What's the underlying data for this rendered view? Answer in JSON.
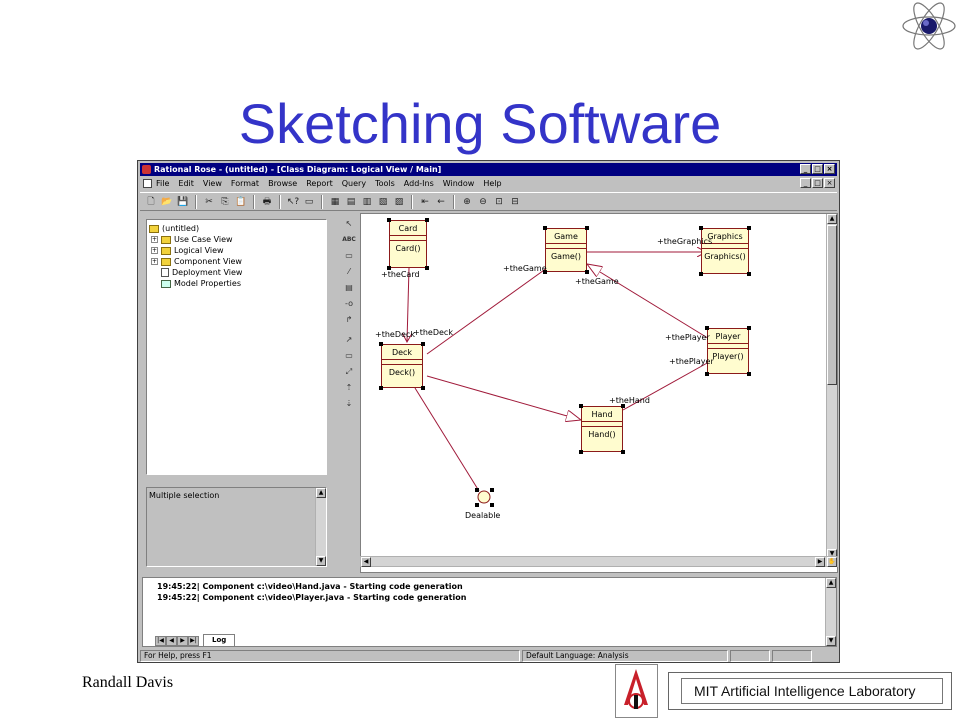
{
  "slide": {
    "title": "Sketching Software",
    "author": "Randall Davis",
    "lab_name": "MIT Artificial Intelligence Laboratory"
  },
  "app": {
    "window_title": "Rational Rose - (untitled) - [Class Diagram: Logical View / Main]",
    "window_buttons": {
      "minimize": "_",
      "maximize": "□",
      "close": "×"
    },
    "menu": [
      "File",
      "Edit",
      "View",
      "Format",
      "Browse",
      "Report",
      "Query",
      "Tools",
      "Add-Ins",
      "Window",
      "Help"
    ],
    "toolbar_icons": [
      "new-icon",
      "open-icon",
      "save-icon",
      "cut-icon",
      "copy-icon",
      "paste-icon",
      "print-icon",
      "context-help-icon",
      "view-doc-icon",
      "browse-class-icon",
      "browse-interaction-icon",
      "browse-component-icon",
      "browse-deployment-icon",
      "browse-parent-icon",
      "browse-previous-icon",
      "zoom-in-icon",
      "zoom-out-icon",
      "fit-window-icon",
      "undo-fit-icon"
    ],
    "browser": {
      "root": "(untitled)",
      "items": [
        {
          "label": "Use Case View",
          "icon": "folder-icon",
          "expandable": true
        },
        {
          "label": "Logical View",
          "icon": "folder-icon",
          "expandable": true
        },
        {
          "label": "Component View",
          "icon": "folder-icon",
          "expandable": true
        },
        {
          "label": "Deployment View",
          "icon": "deployment-icon",
          "expandable": false
        },
        {
          "label": "Model Properties",
          "icon": "model-properties-icon",
          "expandable": false
        }
      ]
    },
    "documentation_text": "Multiple selection",
    "diagram_tools": [
      "selection-tool-icon",
      "text-tool-icon",
      "note-tool-icon",
      "anchor-note-tool-icon",
      "class-tool-icon",
      "interface-tool-icon",
      "association-tool-icon",
      "package-tool-icon",
      "dependency-tool-icon",
      "generalization-tool-icon",
      "realize-tool-icon"
    ],
    "diagram": {
      "classes": [
        {
          "id": "card",
          "name": "Card",
          "operation": "Card()"
        },
        {
          "id": "game",
          "name": "Game",
          "operation": "Game()"
        },
        {
          "id": "graphics",
          "name": "Graphics",
          "operation": "Graphics()"
        },
        {
          "id": "deck",
          "name": "Deck",
          "operation": "Deck()"
        },
        {
          "id": "player",
          "name": "Player",
          "operation": "Player()"
        },
        {
          "id": "hand",
          "name": "Hand",
          "operation": "Hand()"
        }
      ],
      "interface_label": "Dealable",
      "roles": {
        "the_card": "+theCard",
        "the_game_1": "+theGame",
        "the_game_2": "+theGame",
        "the_graphics": "+theGraphics",
        "the_deck_1": "+theDeck",
        "the_deck_2": "+theDeck",
        "the_player_1": "+thePlayer",
        "the_player_2": "+thePlayer",
        "the_hand": "+theHand"
      }
    },
    "log": {
      "lines": [
        "19:45:22|  Component c:\\video\\Hand.java - Starting code generation",
        "19:45:22|  Component c:\\video\\Player.java - Starting code generation"
      ],
      "tab_label": "Log"
    },
    "status": {
      "help": "For Help, press F1",
      "language": "Default Language: Analysis"
    }
  },
  "colors": {
    "title": "#3434c8",
    "titlebar": "#000080",
    "class_fill": "#fffccf",
    "class_border": "#8b1a1a"
  }
}
